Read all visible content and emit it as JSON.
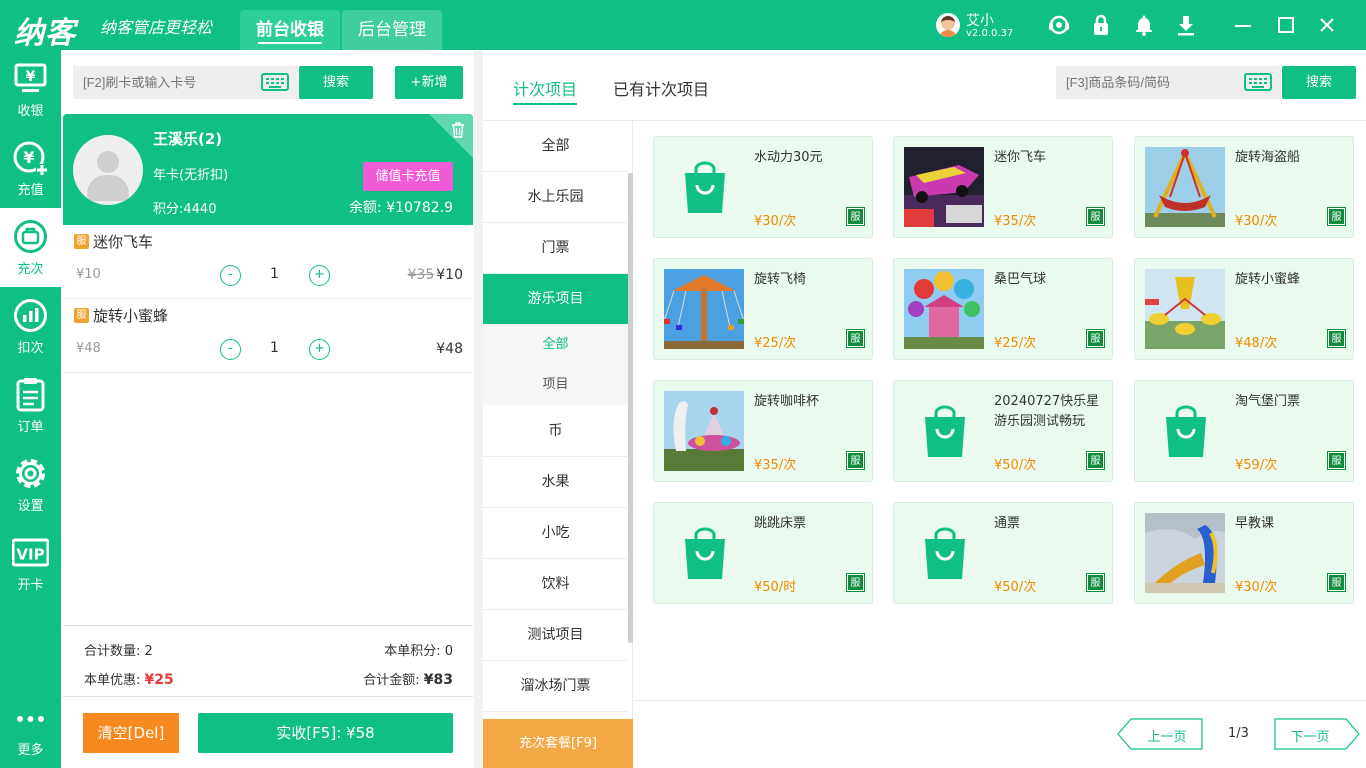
{
  "app": {
    "logo": "纳客",
    "slogan": "纳客管店更轻松",
    "tabs": [
      "前台收银",
      "后台管理"
    ],
    "user": {
      "name": "艾小",
      "version": "v2.0.0.37"
    }
  },
  "sidebar": {
    "items": [
      {
        "label": "收银",
        "icon": "cashier-icon"
      },
      {
        "label": "充值",
        "icon": "recharge-icon"
      },
      {
        "label": "充次",
        "icon": "recharge-count-icon"
      },
      {
        "label": "扣次",
        "icon": "deduct-count-icon"
      },
      {
        "label": "订单",
        "icon": "order-icon"
      },
      {
        "label": "设置",
        "icon": "settings-icon"
      },
      {
        "label": "开卡",
        "icon": "vip-icon",
        "badge": "VIP"
      },
      {
        "label": "更多",
        "icon": "more-icon"
      }
    ]
  },
  "member_search": {
    "placeholder": "[F2]刷卡或输入卡号",
    "search_label": "搜索",
    "add_label": "+新增"
  },
  "member": {
    "name": "王溪乐(2)",
    "card_type": "年卡(无折扣)",
    "points": "积分:4440",
    "balance": "余额: ¥10782.9",
    "recharge_label": "储值卡充值"
  },
  "cart": {
    "items": [
      {
        "badge": "服",
        "name": "迷你飞车",
        "unit_price": "¥10",
        "qty": "1",
        "orig_total": "¥35",
        "total": "¥10"
      },
      {
        "badge": "服",
        "name": "旋转小蜜蜂",
        "unit_price": "¥48",
        "qty": "1",
        "orig_total": "",
        "total": "¥48"
      }
    ],
    "minus": "-",
    "plus": "+"
  },
  "summary": {
    "count_label": "合计数量:",
    "count": "2",
    "points_label": "本单积分:",
    "points": "0",
    "discount_label": "本单优惠:",
    "discount": "¥25",
    "total_label": "合计金额:",
    "total": "¥83"
  },
  "actions": {
    "clear": "清空[Del]",
    "pay": "实收[F5]: ¥58"
  },
  "right_tabs": [
    "计次项目",
    "已有计次项目"
  ],
  "product_search": {
    "placeholder": "[F3]商品条码/简码",
    "search_label": "搜索"
  },
  "categories": [
    {
      "label": "全部"
    },
    {
      "label": "水上乐园"
    },
    {
      "label": "门票"
    },
    {
      "label": "游乐项目",
      "active": true
    },
    {
      "label": "全部",
      "sub": true,
      "active": true
    },
    {
      "label": "项目",
      "sub": true
    },
    {
      "label": "币"
    },
    {
      "label": "水果"
    },
    {
      "label": "小吃"
    },
    {
      "label": "饮料"
    },
    {
      "label": "测试项目"
    },
    {
      "label": "溜冰场门票"
    }
  ],
  "package_label": "充次套餐[F9]",
  "products": [
    {
      "name": "水动力30元",
      "price": "¥30/次",
      "tag": "服",
      "image": "bag-icon"
    },
    {
      "name": "迷你飞车",
      "price": "¥35/次",
      "tag": "服",
      "image": "mini-car-photo"
    },
    {
      "name": "旋转海盗船",
      "price": "¥30/次",
      "tag": "服",
      "image": "pirate-ship-photo"
    },
    {
      "name": "旋转飞椅",
      "price": "¥25/次",
      "tag": "服",
      "image": "swing-chair-photo"
    },
    {
      "name": "桑巴气球",
      "price": "¥25/次",
      "tag": "服",
      "image": "samba-balloon-photo"
    },
    {
      "name": "旋转小蜜蜂",
      "price": "¥48/次",
      "tag": "服",
      "image": "bee-ride-photo"
    },
    {
      "name": "旋转咖啡杯",
      "price": "¥35/次",
      "tag": "服",
      "image": "coffee-cup-photo"
    },
    {
      "name": "20240727快乐星游乐园测试畅玩",
      "price": "¥50/次",
      "tag": "服",
      "image": "bag-icon"
    },
    {
      "name": "淘气堡门票",
      "price": "¥59/次",
      "tag": "服",
      "image": "bag-icon"
    },
    {
      "name": "跳跳床票",
      "price": "¥50/时",
      "tag": "服",
      "image": "bag-icon"
    },
    {
      "name": "通票",
      "price": "¥50/次",
      "tag": "服",
      "image": "bag-icon"
    },
    {
      "name": "早教课",
      "price": "¥30/次",
      "tag": "服",
      "image": "slide-photo"
    }
  ],
  "pagination": {
    "prev": "上一页",
    "page": "1/3",
    "next": "下一页"
  },
  "colors": {
    "brand": "#0fbf86",
    "price": "#f08a00",
    "discount": "#e93a3a",
    "clear": "#f68a1e",
    "package": "#f4a845",
    "recharge": "#f15bd8"
  }
}
